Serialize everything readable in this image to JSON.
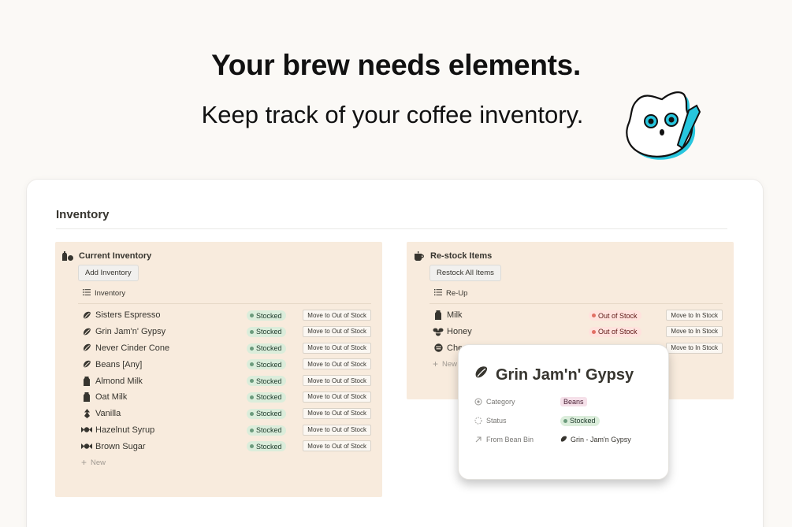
{
  "hero": {
    "title": "Your brew needs elements.",
    "subtitle": "Keep track of your coffee inventory."
  },
  "card": {
    "title": "Inventory"
  },
  "current_inventory": {
    "title": "Current Inventory",
    "action_button": "Add Inventory",
    "view_name": "Inventory",
    "new_label": "New",
    "rows": [
      {
        "name": "Sisters Espresso",
        "icon": "bean-icon",
        "status": "Stocked",
        "action": "Move to Out of Stock"
      },
      {
        "name": "Grin Jam'n' Gypsy",
        "icon": "bean-icon",
        "status": "Stocked",
        "action": "Move to Out of Stock"
      },
      {
        "name": "Never Cinder Cone",
        "icon": "bean-icon",
        "status": "Stocked",
        "action": "Move to Out of Stock"
      },
      {
        "name": "Beans [Any]",
        "icon": "bean-icon",
        "status": "Stocked",
        "action": "Move to Out of Stock"
      },
      {
        "name": "Almond Milk",
        "icon": "milk-carton-icon",
        "status": "Stocked",
        "action": "Move to Out of Stock"
      },
      {
        "name": "Oat Milk",
        "icon": "milk-carton-icon",
        "status": "Stocked",
        "action": "Move to Out of Stock"
      },
      {
        "name": "Vanilla",
        "icon": "vanilla-icon",
        "status": "Stocked",
        "action": "Move to Out of Stock"
      },
      {
        "name": "Hazelnut Syrup",
        "icon": "candy-icon",
        "status": "Stocked",
        "action": "Move to Out of Stock"
      },
      {
        "name": "Brown Sugar",
        "icon": "candy-icon",
        "status": "Stocked",
        "action": "Move to Out of Stock"
      }
    ]
  },
  "restock": {
    "title": "Re-stock Items",
    "action_button": "Restock All Items",
    "view_name": "Re-Up",
    "new_label": "New",
    "rows": [
      {
        "name": "Milk",
        "icon": "milk-carton-icon",
        "status": "Out of Stock",
        "action": "Move to In Stock"
      },
      {
        "name": "Honey",
        "icon": "bee-icon",
        "status": "Out of Stock",
        "action": "Move to In Stock"
      },
      {
        "name": "Chem",
        "icon": "chemex-icon",
        "status": "",
        "action": "Move to In Stock"
      }
    ]
  },
  "popover": {
    "title": "Grin Jam'n' Gypsy",
    "props": [
      {
        "name": "Category",
        "value": "Beans"
      },
      {
        "name": "Status",
        "value": "Stocked"
      },
      {
        "name": "From Bean Bin",
        "value": "Grin - Jam'n Gypsy"
      }
    ]
  },
  "colors": {
    "panel_bg": "#f8ebdd",
    "stocked_bg": "#dbeddb",
    "out_of_stock_bg": "#ffe2dd",
    "beans_tag_bg": "#f5e0e9",
    "mascot_accent": "#27c6de"
  }
}
